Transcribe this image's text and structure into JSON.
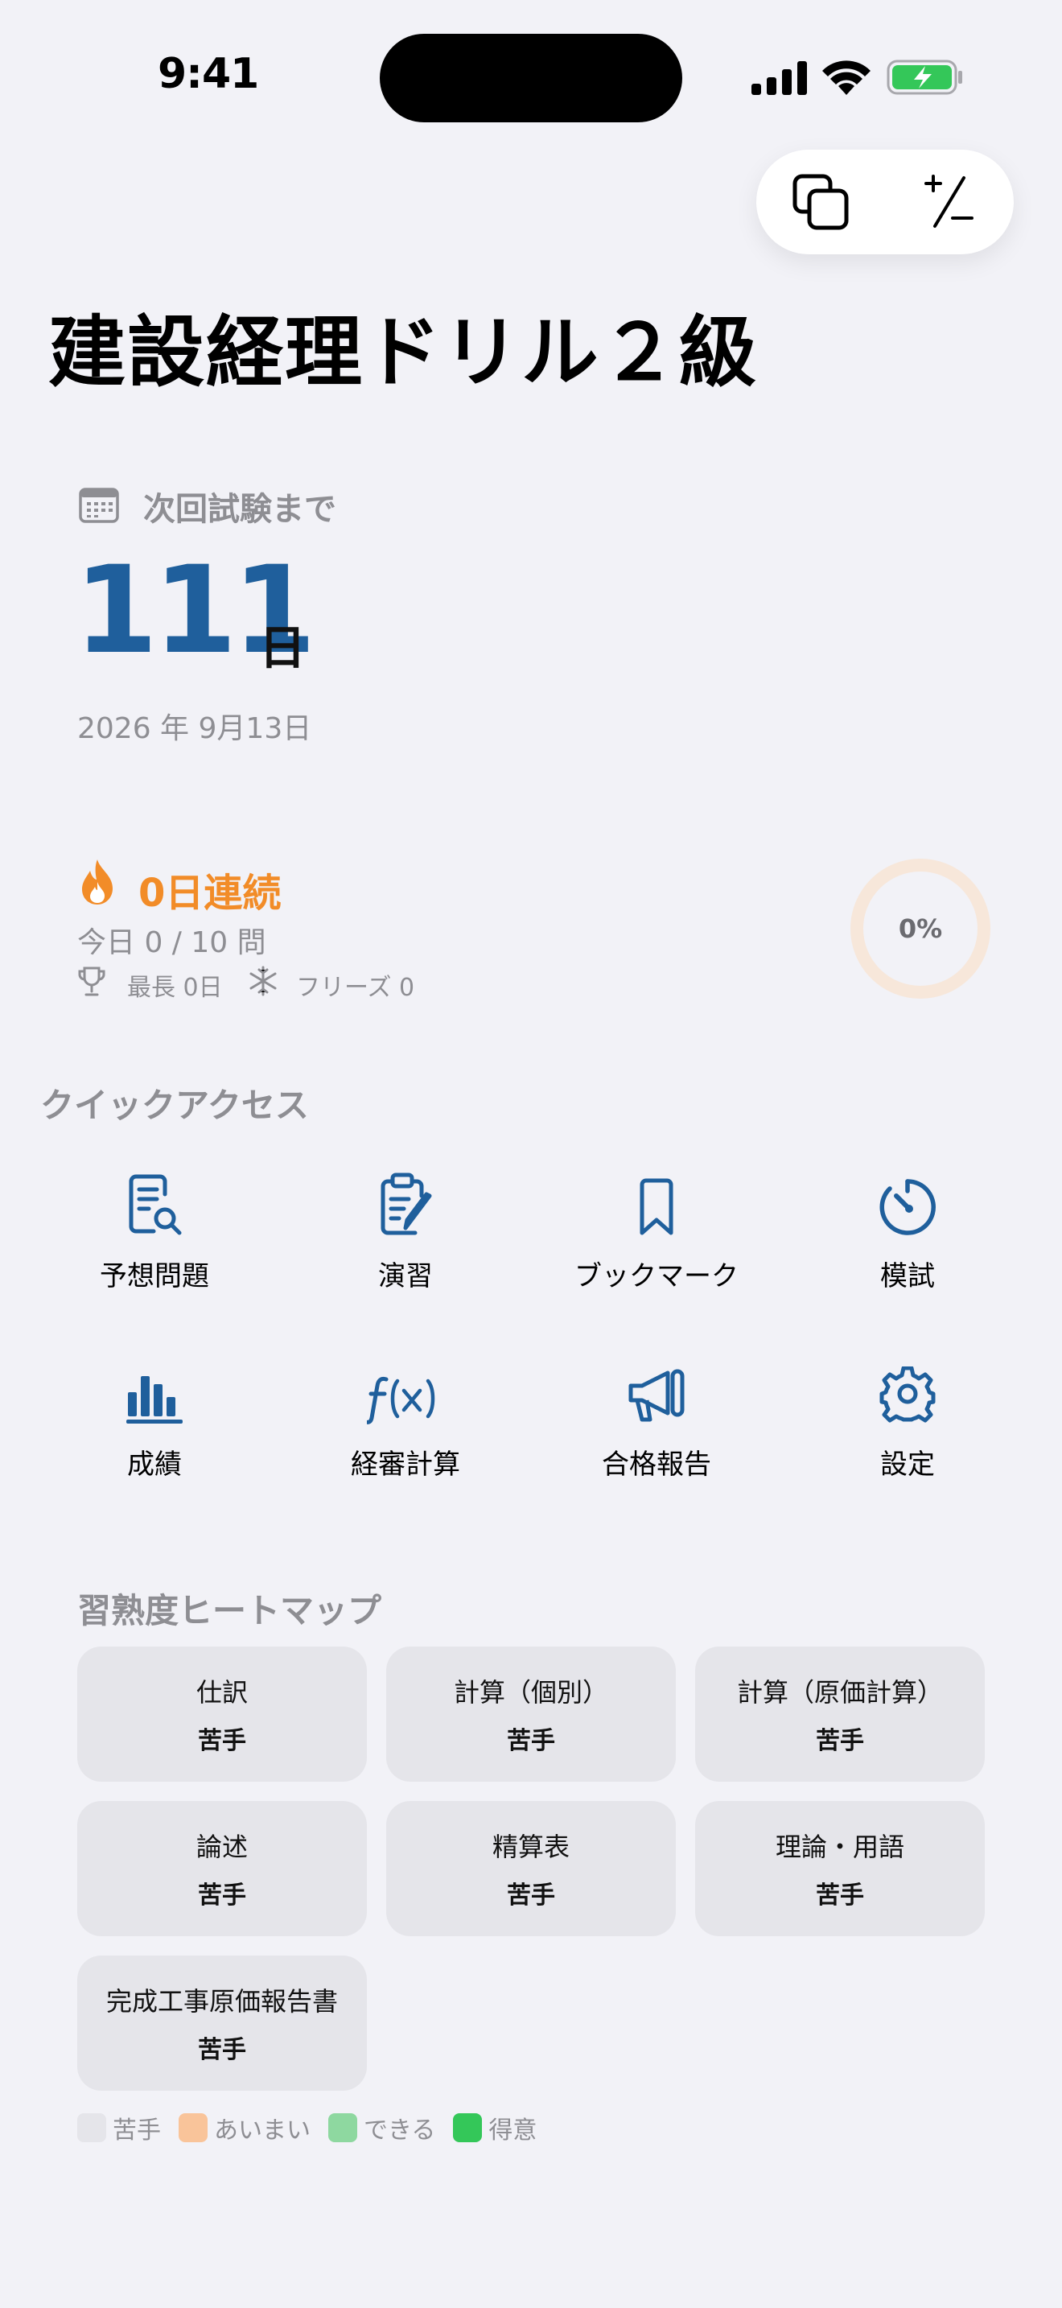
{
  "status_bar": {
    "time": "9:41"
  },
  "app": {
    "title": "建設経理ドリル２級"
  },
  "countdown": {
    "label": "次回試験まで",
    "days": "111",
    "unit": "日",
    "date": "2026 年 9月13日"
  },
  "streak": {
    "title": "0日連続",
    "today": "今日 0 / 10 問",
    "best": "最長 0日",
    "freeze": "フリーズ 0",
    "progress_percent": 0,
    "progress_text": "0%"
  },
  "quick_access": {
    "title": "クイックアクセス",
    "items": [
      {
        "label": "予想問題",
        "icon": "document-search-icon"
      },
      {
        "label": "演習",
        "icon": "clipboard-pen-icon"
      },
      {
        "label": "ブックマーク",
        "icon": "bookmark-icon"
      },
      {
        "label": "模試",
        "icon": "timer-icon"
      },
      {
        "label": "成績",
        "icon": "bar-chart-icon"
      },
      {
        "label": "経審計算",
        "icon": "function-icon"
      },
      {
        "label": "合格報告",
        "icon": "megaphone-icon"
      },
      {
        "label": "設定",
        "icon": "gear-icon"
      }
    ]
  },
  "heatmap": {
    "title": "習熟度ヒートマップ",
    "tiles": [
      {
        "name": "仕訳",
        "level": "苦手"
      },
      {
        "name": "計算（個別）",
        "level": "苦手"
      },
      {
        "name": "計算（原価計算）",
        "level": "苦手"
      },
      {
        "name": "論述",
        "level": "苦手"
      },
      {
        "name": "精算表",
        "level": "苦手"
      },
      {
        "name": "理論・用語",
        "level": "苦手"
      },
      {
        "name": "完成工事原価報告書",
        "level": "苦手"
      }
    ],
    "legend": [
      {
        "label": "苦手",
        "color": "#E5E5EA"
      },
      {
        "label": "あいまい",
        "color": "#F9C49A"
      },
      {
        "label": "できる",
        "color": "#8ED8A0"
      },
      {
        "label": "得意",
        "color": "#34C759"
      }
    ]
  },
  "colors": {
    "accent": "#1F5F9C",
    "streak": "#F28C28",
    "background": "#F2F2F7"
  }
}
